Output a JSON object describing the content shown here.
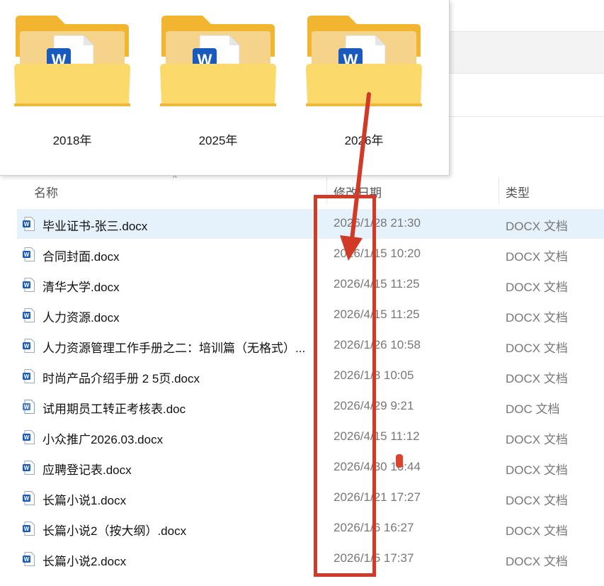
{
  "folders": [
    {
      "label": "2018年"
    },
    {
      "label": "2025年"
    },
    {
      "label": "2026年"
    }
  ],
  "columns": {
    "name": "名称",
    "date": "修改日期",
    "type": "类型"
  },
  "files": [
    {
      "name": "毕业证书-张三.docx",
      "date": "2026/1/28 21:30",
      "type": "DOCX 文档",
      "icon": "word-doc-icon",
      "selected": true
    },
    {
      "name": "合同封面.docx",
      "date": "2026/1/15 10:20",
      "type": "DOCX 文档",
      "icon": "word-doc-icon"
    },
    {
      "name": "清华大学.docx",
      "date": "2026/4/15 11:25",
      "type": "DOCX 文档",
      "icon": "word-doc-icon"
    },
    {
      "name": "人力资源.docx",
      "date": "2026/4/15 11:25",
      "type": "DOCX 文档",
      "icon": "word-doc-icon"
    },
    {
      "name": "人力资源管理工作手册之二：培训篇（无格式）...",
      "date": "2026/1/26 10:58",
      "type": "DOCX 文档",
      "icon": "word-doc-icon"
    },
    {
      "name": "时尚产品介绍手册  2     5页.docx",
      "date": "2026/1/8 10:05",
      "type": "DOCX 文档",
      "icon": "word-doc-icon"
    },
    {
      "name": "试用期员工转正考核表.doc",
      "date": "2026/4/29 9:21",
      "type": "DOC 文档",
      "icon": "word-doc-old-icon"
    },
    {
      "name": "小众推广2026.03.docx",
      "date": "2026/4/15 11:12",
      "type": "DOCX 文档",
      "icon": "word-doc-icon"
    },
    {
      "name": "应聘登记表.docx",
      "date": "2026/4/30 10:44",
      "type": "DOCX 文档",
      "icon": "word-doc-icon"
    },
    {
      "name": "长篇小说1.docx",
      "date": "2026/1/21 17:27",
      "type": "DOCX 文档",
      "icon": "word-doc-icon"
    },
    {
      "name": "长篇小说2（按大纲）.docx",
      "date": "2026/1/6 16:27",
      "type": "DOCX 文档",
      "icon": "word-doc-icon"
    },
    {
      "name": "长篇小说2.docx",
      "date": "2026/1/5 17:37",
      "type": "DOCX 文档",
      "icon": "word-doc-icon"
    }
  ],
  "colors": {
    "annotation_red": "#d13a27",
    "selection": "#e5f1fb",
    "word_blue": "#185abd",
    "folder_yellow": "#f7c948"
  }
}
